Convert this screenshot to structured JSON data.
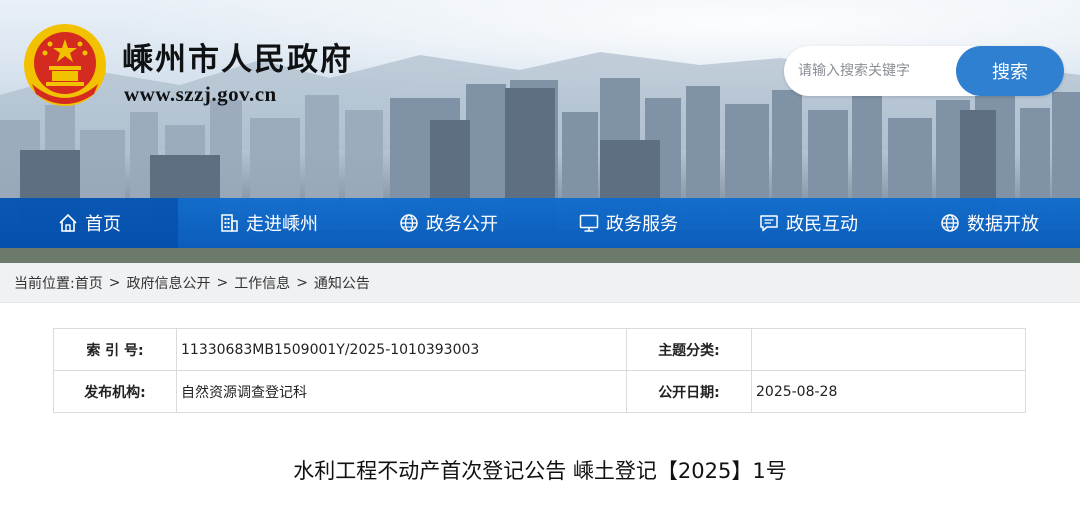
{
  "site": {
    "title": "嵊州市人民政府",
    "url": "www.szzj.gov.cn"
  },
  "search": {
    "placeholder": "请输入搜索关键字",
    "button_label": "搜索"
  },
  "nav": {
    "items": [
      {
        "label": "首页",
        "icon": "home-icon",
        "active": true
      },
      {
        "label": "走进嵊州",
        "icon": "building-icon",
        "active": false
      },
      {
        "label": "政务公开",
        "icon": "globe-icon",
        "active": false
      },
      {
        "label": "政务服务",
        "icon": "monitor-icon",
        "active": false
      },
      {
        "label": "政民互动",
        "icon": "chat-icon",
        "active": false
      },
      {
        "label": "数据开放",
        "icon": "globe-icon",
        "active": false
      }
    ]
  },
  "breadcrumb": {
    "prefix": "当前位置:",
    "items": [
      "首页",
      "政府信息公开",
      "工作信息",
      "通知公告"
    ]
  },
  "meta": {
    "index_label": "索 引 号:",
    "index_value": "11330683MB1509001Y/2025-1010393003",
    "topic_label": "主题分类:",
    "topic_value": "",
    "publisher_label": "发布机构:",
    "publisher_value": "自然资源调查登记科",
    "date_label": "公开日期:",
    "date_value": "2025-08-28"
  },
  "document": {
    "title": "水利工程不动产首次登记公告 嵊土登记【2025】1号"
  },
  "colors": {
    "nav_blue": "#0a63c6",
    "search_button": "#2f80d0",
    "emblem_red": "#d42a1f",
    "emblem_gold": "#f2c200"
  }
}
